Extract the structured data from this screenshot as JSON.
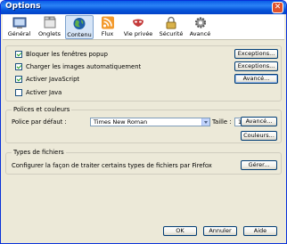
{
  "window": {
    "title": "Options",
    "close_glyph": "✕"
  },
  "toolbar": [
    {
      "label": "Général",
      "icon": "general-icon"
    },
    {
      "label": "Onglets",
      "icon": "tabs-icon"
    },
    {
      "label": "Contenu",
      "icon": "globe-icon",
      "active": true
    },
    {
      "label": "Flux",
      "icon": "rss-feed-icon"
    },
    {
      "label": "Vie privée",
      "icon": "privacy-mask-icon"
    },
    {
      "label": "Sécurité",
      "icon": "padlock-icon"
    },
    {
      "label": "Avancé",
      "icon": "gear-icon"
    }
  ],
  "content": {
    "checks": [
      {
        "label": "Bloquer les fenêtres popup",
        "checked": true,
        "button": "Exceptions..."
      },
      {
        "label": "Charger les images automatiquement",
        "checked": true,
        "button": "Exceptions..."
      },
      {
        "label": "Activer JavaScript",
        "checked": true,
        "button": "Avancé..."
      },
      {
        "label": "Activer Java",
        "checked": false
      }
    ]
  },
  "fonts": {
    "group_label": "Polices et couleurs",
    "default_font_label": "Police par défaut :",
    "default_font_value": "Times New Roman",
    "size_label": "Taille :",
    "size_value": "16",
    "advanced_button": "Avancé...",
    "colors_button": "Couleurs..."
  },
  "filetypes": {
    "group_label": "Types de fichiers",
    "description": "Configurer la façon de traiter certains types de fichiers par Firefox",
    "manage_button": "Gérer..."
  },
  "footer": {
    "ok": "OK",
    "cancel": "Annuler",
    "help": "Aide"
  }
}
